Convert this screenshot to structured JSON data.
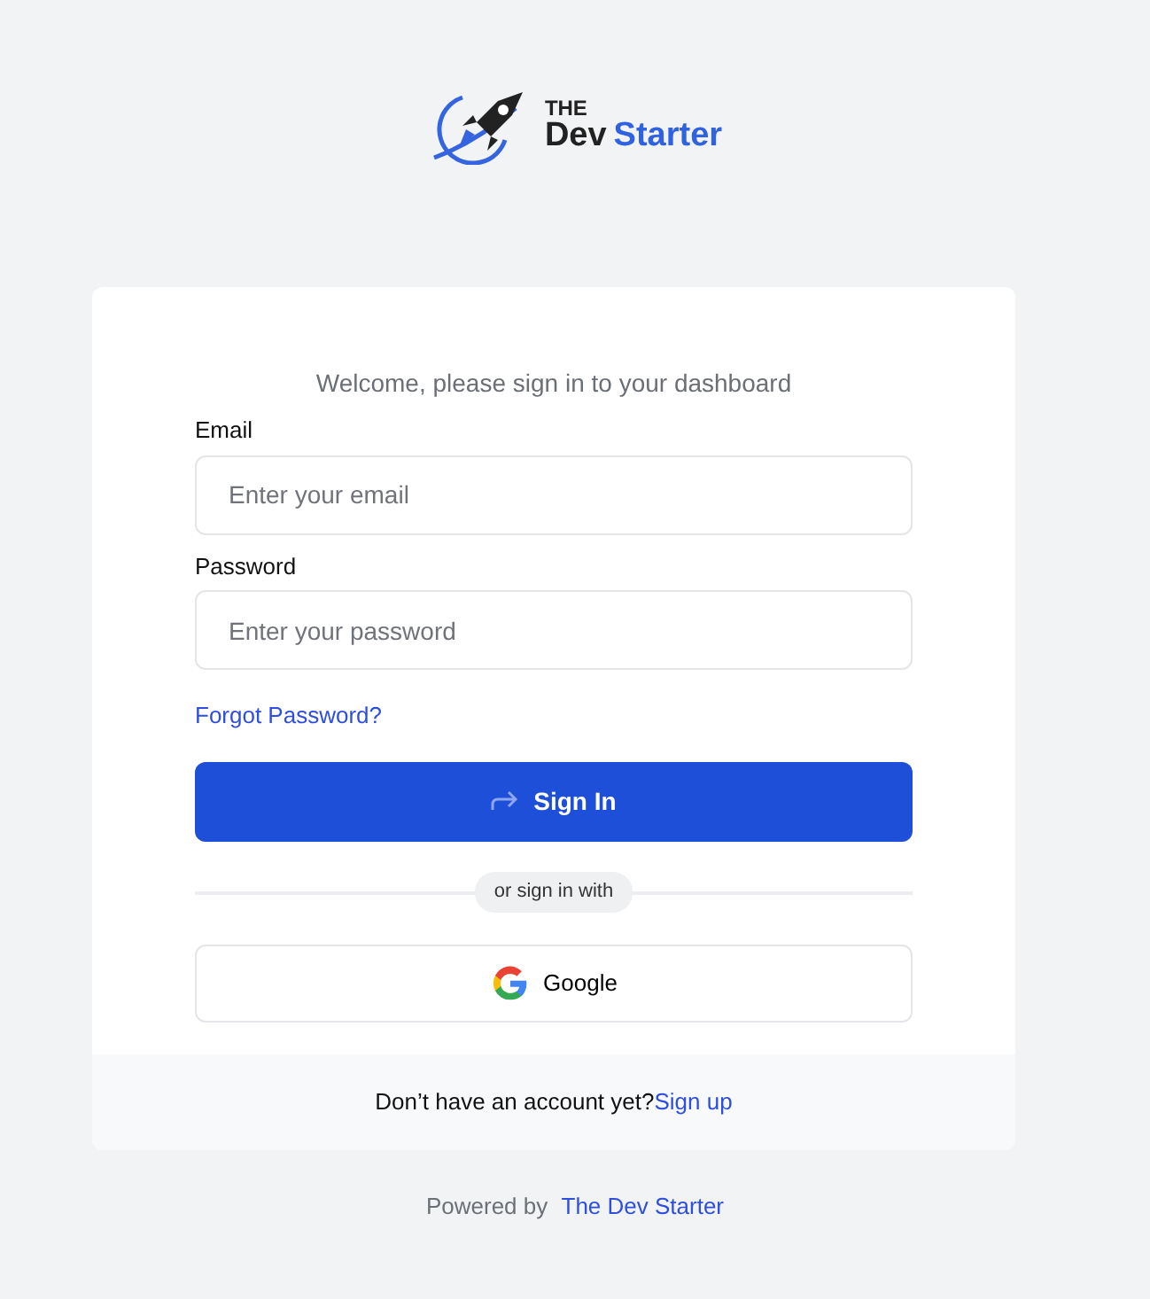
{
  "logo": {
    "top_word": "THE",
    "word_1": "Dev",
    "word_2": "Starter"
  },
  "card": {
    "subtitle": "Welcome, please sign in to your dashboard",
    "fields": [
      {
        "label": "Email",
        "placeholder": "Enter your email"
      },
      {
        "label": "Password",
        "placeholder": "Enter your password"
      }
    ],
    "forgot_link": "Forgot Password?",
    "submit_button": "Sign In",
    "divider_text": "or sign in with",
    "social_button": "Google",
    "footer": {
      "text": "Don’t have an account yet?",
      "link": "Sign up"
    }
  },
  "powered_by": {
    "text": "Powered by",
    "link": "The Dev Starter"
  }
}
